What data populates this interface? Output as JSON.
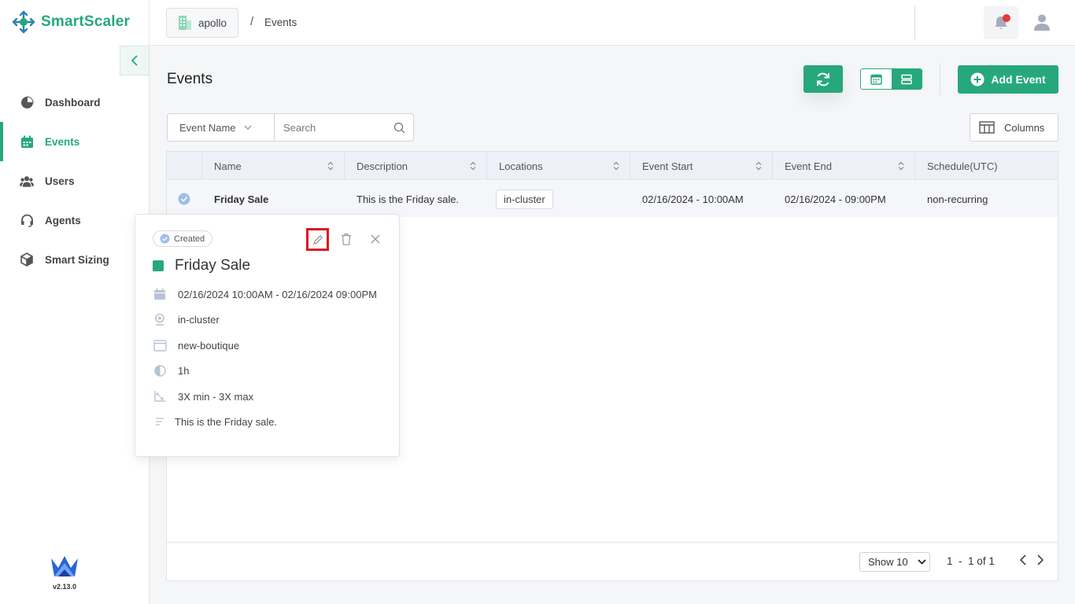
{
  "app": {
    "name": "SmartScaler",
    "version": "v2.13.0"
  },
  "colors": {
    "accent": "#26a87c",
    "alert": "#e53935",
    "highlight": "#e0161f"
  },
  "sidebar": {
    "items": [
      {
        "label": "Dashboard",
        "icon": "pie-chart-icon",
        "active": false
      },
      {
        "label": "Events",
        "icon": "calendar-icon",
        "active": true
      },
      {
        "label": "Users",
        "icon": "users-icon",
        "active": false
      },
      {
        "label": "Agents",
        "icon": "headset-icon",
        "active": false
      },
      {
        "label": "Smart Sizing",
        "icon": "cube-icon",
        "active": false
      }
    ]
  },
  "header": {
    "org": "apollo",
    "separator": "/",
    "page": "Events"
  },
  "main": {
    "title": "Events",
    "add_button": "Add Event",
    "columns_button": "Columns",
    "filter": {
      "field": "Event Name",
      "search_placeholder": "Search"
    }
  },
  "table": {
    "columns": [
      "Name",
      "Description",
      "Locations",
      "Event Start",
      "Event End",
      "Schedule(UTC)"
    ],
    "rows": [
      {
        "name": "Friday Sale",
        "description": "This is the Friday sale.",
        "location": "in-cluster",
        "start": "02/16/2024 - 10:00AM",
        "end": "02/16/2024 - 09:00PM",
        "schedule": "non-recurring"
      }
    ],
    "footer": {
      "show": "Show 10",
      "range_from": "1",
      "range_dash": "-",
      "range_text": "1 of 1"
    }
  },
  "popover": {
    "status": "Created",
    "title": "Friday Sale",
    "datetime": "02/16/2024 10:00AM - 02/16/2024 09:00PM",
    "location": "in-cluster",
    "app": "new-boutique",
    "duration": "1h",
    "scaling": "3X min - 3X max",
    "description": "This is the Friday sale."
  }
}
